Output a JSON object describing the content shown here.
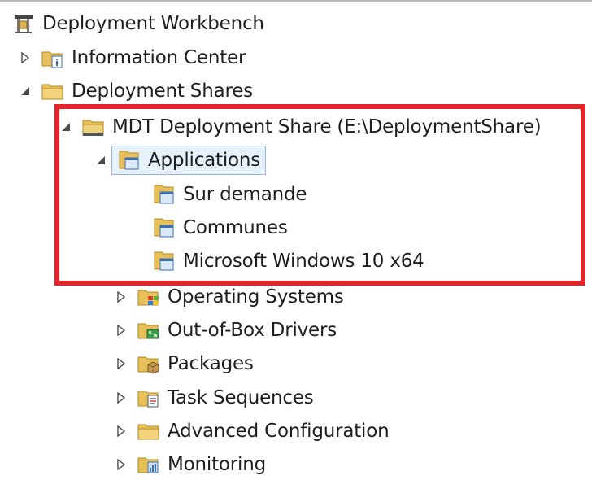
{
  "tree": {
    "root": {
      "label": "Deployment Workbench",
      "icon": "deployment-workbench-icon"
    },
    "items": [
      {
        "label": "Information Center",
        "icon": "information-center-icon",
        "expander": "collapsed"
      },
      {
        "label": "Deployment Shares",
        "icon": "folder-icon",
        "expander": "expanded"
      },
      {
        "label": "MDT Deployment Share (E:\\DeploymentShare)",
        "icon": "share-folder-icon",
        "expander": "expanded"
      },
      {
        "label": "Applications",
        "icon": "applications-folder-icon",
        "expander": "expanded",
        "selected": true
      },
      {
        "label": "Sur demande",
        "icon": "applications-folder-icon"
      },
      {
        "label": "Communes",
        "icon": "applications-folder-icon"
      },
      {
        "label": "Microsoft Windows 10 x64",
        "icon": "applications-folder-icon"
      },
      {
        "label": "Operating Systems",
        "icon": "operating-systems-icon",
        "expander": "collapsed"
      },
      {
        "label": "Out-of-Box Drivers",
        "icon": "drivers-icon",
        "expander": "collapsed"
      },
      {
        "label": "Packages",
        "icon": "packages-icon",
        "expander": "collapsed"
      },
      {
        "label": "Task Sequences",
        "icon": "task-sequences-icon",
        "expander": "collapsed"
      },
      {
        "label": "Advanced Configuration",
        "icon": "folder-icon",
        "expander": "collapsed"
      },
      {
        "label": "Monitoring",
        "icon": "monitoring-icon",
        "expander": "collapsed"
      }
    ]
  },
  "colors": {
    "highlight": "#e3242b",
    "selection_bg": "#e5f1fb",
    "selection_border": "#8fb6e1",
    "folder": "#e8c05a"
  }
}
